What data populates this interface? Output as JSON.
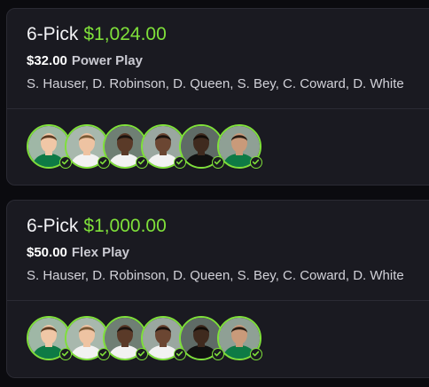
{
  "colors": {
    "background": "#0b0b0f",
    "card": "#1a1a21",
    "accent": "#7fe03a",
    "text": "#e9e9ee",
    "muted": "#c9c9d1"
  },
  "entries": [
    {
      "picks_label": "6-Pick",
      "payout": "$1,024.00",
      "stake": "$32.00",
      "play_type": "Power Play",
      "players": "S. Hauser, D. Robinson, D. Queen, S. Bey, C. Coward, D. White",
      "avatars": [
        {
          "icon": "player-avatar-icon",
          "status": "check-icon"
        },
        {
          "icon": "player-avatar-icon",
          "status": "check-icon"
        },
        {
          "icon": "player-avatar-icon",
          "status": "check-icon"
        },
        {
          "icon": "player-avatar-icon",
          "status": "check-icon"
        },
        {
          "icon": "player-avatar-icon",
          "status": "check-icon"
        },
        {
          "icon": "player-avatar-icon",
          "status": "check-icon"
        }
      ]
    },
    {
      "picks_label": "6-Pick",
      "payout": "$1,000.00",
      "stake": "$50.00",
      "play_type": "Flex Play",
      "players": "S. Hauser, D. Robinson, D. Queen, S. Bey, C. Coward, D. White",
      "avatars": [
        {
          "icon": "player-avatar-icon",
          "status": "check-icon"
        },
        {
          "icon": "player-avatar-icon",
          "status": "check-icon"
        },
        {
          "icon": "player-avatar-icon",
          "status": "check-icon"
        },
        {
          "icon": "player-avatar-icon",
          "status": "check-icon"
        },
        {
          "icon": "player-avatar-icon",
          "status": "check-icon"
        },
        {
          "icon": "player-avatar-icon",
          "status": "check-icon"
        }
      ]
    }
  ]
}
